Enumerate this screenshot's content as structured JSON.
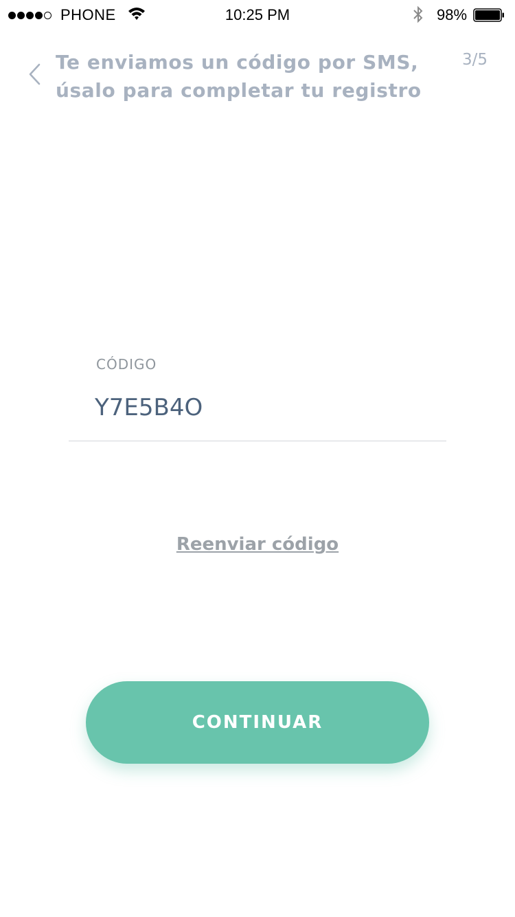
{
  "status_bar": {
    "carrier": "PHONE",
    "time": "10:25 PM",
    "battery_percent": "98%",
    "battery_level": 0.98,
    "signal_bars_filled": 4,
    "signal_bars_total": 5,
    "icons": [
      "wifi-icon",
      "bluetooth-icon",
      "battery-icon"
    ]
  },
  "header": {
    "title_line1": "Te enviamos un código por SMS,",
    "title_line2": "úsalo para completar tu registro",
    "step": "3/5",
    "back_icon": "chevron-left-icon"
  },
  "form": {
    "code_label": "CÓDIGO",
    "code_value": "Y7E5B4O"
  },
  "actions": {
    "resend_label": "Reenviar código",
    "continue_label": "CONTINUAR"
  },
  "colors": {
    "accent": "#68c4ac",
    "title_text": "#a8b2c0",
    "input_text": "#4c627c",
    "label_text": "#8f969d",
    "link_text": "#9ca2a8",
    "divider": "#d3d6da"
  }
}
